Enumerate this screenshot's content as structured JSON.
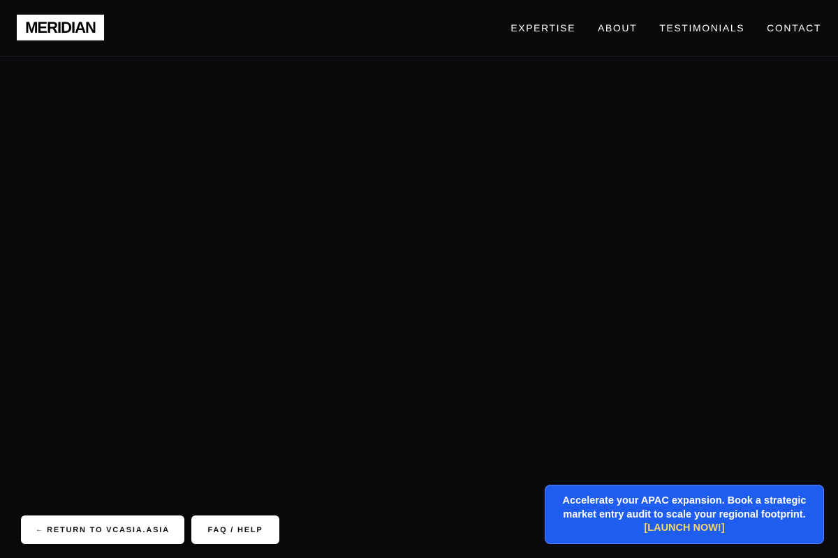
{
  "header": {
    "logo_text": "MERIDIAN",
    "nav": [
      {
        "label": "EXPERTISE"
      },
      {
        "label": "ABOUT"
      },
      {
        "label": "TESTIMONIALS"
      },
      {
        "label": "CONTACT"
      }
    ]
  },
  "footer_buttons": {
    "return_arrow": "←",
    "return_label": "RETURN TO VCASIA.ASIA",
    "faq_label": "FAQ / HELP"
  },
  "promo": {
    "message": "Accelerate your APAC expansion. Book a strategic market entry audit to scale your regional footprint.",
    "cta": "[LAUNCH NOW!]"
  },
  "colors": {
    "background": "#0a0a0c",
    "promo_bg": "#1f5cf0",
    "promo_cta": "#f3d76a",
    "text": "#ffffff"
  }
}
